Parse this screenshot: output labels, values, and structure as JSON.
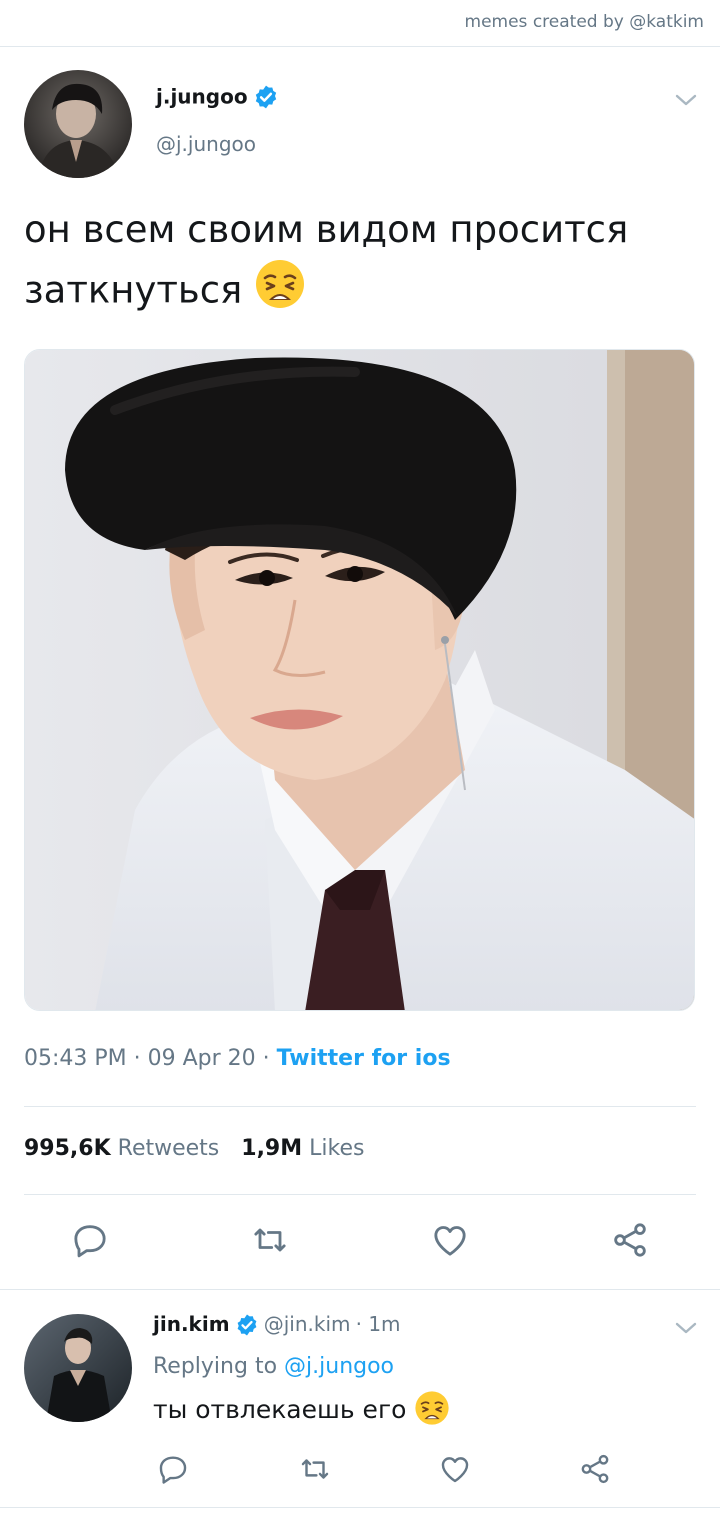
{
  "credit": "memes created by @katkim",
  "tweet": {
    "name": "j.jungoo",
    "handle": "@j.jungoo",
    "text_line1": "он всем своим видом просится",
    "text_line2": "заткнуться",
    "emoji": "weary-face",
    "time": "05:43 PM",
    "sep1": " · ",
    "date": "09 Apr 20",
    "sep2": " · ",
    "source": "Twitter for ios",
    "retweets_count": "995,6K",
    "retweets_label": "Retweets",
    "likes_count": "1,9M",
    "likes_label": "Likes"
  },
  "reply": {
    "name": "jin.kim",
    "handle": "@jin.kim",
    "time": "· 1m",
    "replying_prefix": "Replying to",
    "replying_to": "@j.jungoo",
    "text": "ты отвлекаешь его",
    "emoji": "weary-face"
  },
  "icons": [
    "verified-badge-icon",
    "chevron-down-icon",
    "reply-icon",
    "retweet-icon",
    "like-icon",
    "share-icon"
  ],
  "colors": {
    "accent": "#1da1f2",
    "secondary_text": "#657786",
    "divider": "#e1e8ed"
  }
}
